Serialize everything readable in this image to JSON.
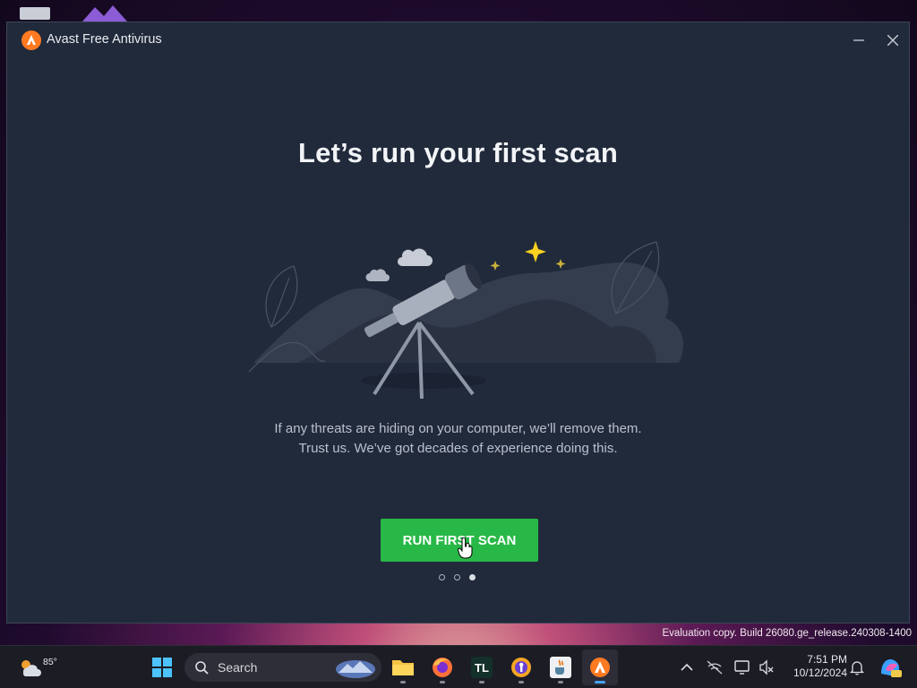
{
  "window": {
    "title": "Avast Free Antivirus",
    "minimize_icon": "minimize-icon",
    "close_icon": "close-icon"
  },
  "onboarding": {
    "headline": "Let’s run your first scan",
    "body_line1": "If any threats are hiding on your computer, we’ll remove them.",
    "body_line2": "Trust us. We’ve got decades of experience doing this.",
    "cta_label": "RUN FIRST SCAN",
    "illustration": "telescope-under-starry-sky",
    "pagination": {
      "total": 3,
      "active": 3
    }
  },
  "desktop": {
    "watermark": "Evaluation copy. Build 26080.ge_release.240308-1400"
  },
  "taskbar": {
    "weather_temp": "85°",
    "search_placeholder": "Search",
    "apps": [
      "file-explorer",
      "firefox",
      "tl-app",
      "proton-pass",
      "java-app",
      "avast"
    ],
    "active_app": "avast",
    "clock_time": "7:51 PM",
    "clock_date": "10/12/2024"
  },
  "colors": {
    "window_bg": "#212a3b",
    "accent_orange": "#ff7a21",
    "cta_green": "#28b847"
  }
}
